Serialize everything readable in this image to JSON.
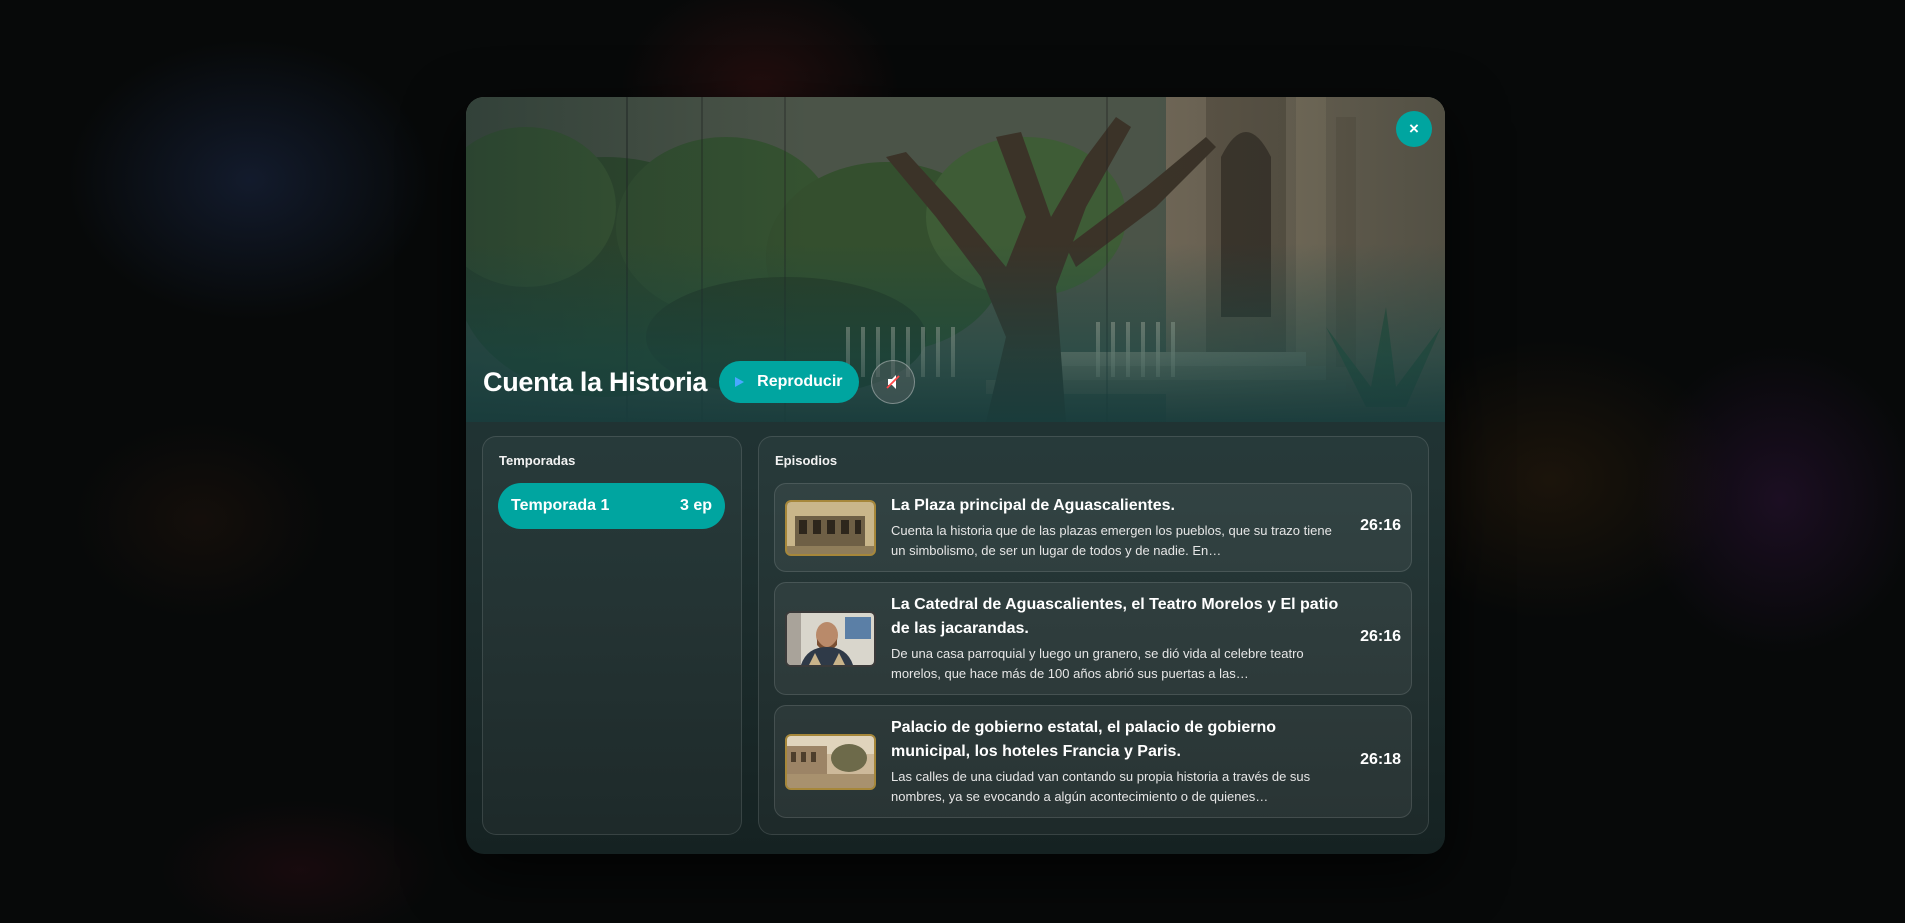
{
  "show": {
    "title": "Cuenta la Historia",
    "play_label": "Reproducir",
    "mute_icon": "speaker-muted-icon",
    "close_icon": "close-icon",
    "close_symbol": "×"
  },
  "seasons": {
    "heading": "Temporadas",
    "items": [
      {
        "label": "Temporada 1",
        "count": "3 ep"
      }
    ]
  },
  "episodes": {
    "heading": "Episodios",
    "items": [
      {
        "title": "La Plaza principal de Aguascalientes.",
        "description": "Cuenta la historia que de las plazas emergen los pueblos, que su trazo tiene un simbolismo, de ser un lugar de todos y de nadie. En…",
        "duration": "26:16"
      },
      {
        "title": "La Catedral de Aguascalientes, el Teatro Morelos y El patio de las jacarandas.",
        "description": "De una casa parroquial y luego un granero, se dió vida al celebre teatro morelos, que hace más de 100 años abrió sus puertas a las…",
        "duration": "26:16"
      },
      {
        "title": "Palacio de gobierno estatal, el palacio de gobierno municipal, los hoteles Francia y Paris.",
        "description": "Las calles de una ciudad van contando su propia historia a través de sus nombres, ya se evocando a algún acontecimiento o de quienes…",
        "duration": "26:18"
      }
    ]
  },
  "colors": {
    "accent": "#00a5a0",
    "panel_border": "#2e4444",
    "thumb_frame": "#a6873a"
  }
}
